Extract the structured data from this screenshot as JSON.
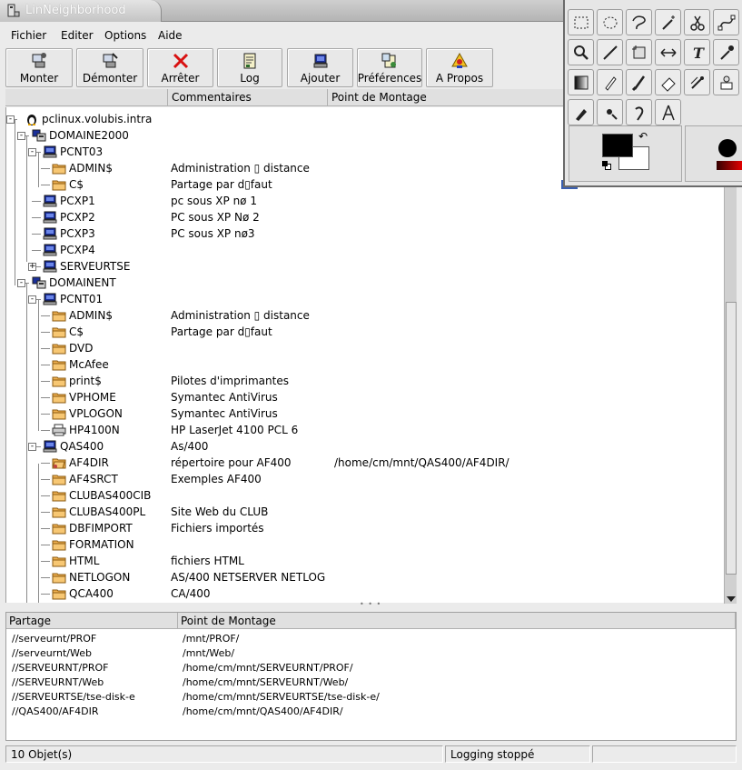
{
  "window": {
    "title": "LinNeighborhood"
  },
  "menu": [
    "Fichier",
    "Editer",
    "Options",
    "Aide"
  ],
  "toolbar": [
    {
      "label": "Monter",
      "icon": "mount-icon"
    },
    {
      "label": "Démonter",
      "icon": "unmount-icon"
    },
    {
      "label": "Arrêter",
      "icon": "stop-icon"
    },
    {
      "label": "Log",
      "icon": "log-icon"
    },
    {
      "label": "Ajouter",
      "icon": "add-host-icon"
    },
    {
      "label": "Préférences",
      "icon": "preferences-icon"
    },
    {
      "label": "A Propos",
      "icon": "about-icon"
    }
  ],
  "tree_columns": [
    "",
    "Commentaires",
    "Point de Montage"
  ],
  "tree": [
    {
      "name": "pclinux.volubis.intra",
      "type": "root",
      "depth": 0,
      "expander": "-",
      "comment": "",
      "mount": ""
    },
    {
      "name": "DOMAINE2000",
      "type": "domain",
      "depth": 1,
      "expander": "-",
      "comment": "",
      "mount": ""
    },
    {
      "name": "PCNT03",
      "type": "host",
      "depth": 2,
      "expander": "-",
      "comment": "",
      "mount": ""
    },
    {
      "name": "ADMIN$",
      "type": "folder",
      "depth": 3,
      "comment": "Administration ▯ distance",
      "mount": ""
    },
    {
      "name": "C$",
      "type": "folder",
      "depth": 3,
      "comment": "Partage par d▯faut",
      "mount": ""
    },
    {
      "name": "PCXP1",
      "type": "host",
      "depth": 2,
      "comment": "pc sous XP nø 1",
      "mount": ""
    },
    {
      "name": "PCXP2",
      "type": "host",
      "depth": 2,
      "comment": "PC sous XP Nø 2",
      "mount": ""
    },
    {
      "name": "PCXP3",
      "type": "host",
      "depth": 2,
      "comment": "PC sous XP nø3",
      "mount": ""
    },
    {
      "name": "PCXP4",
      "type": "host",
      "depth": 2,
      "comment": "",
      "mount": ""
    },
    {
      "name": "SERVEURTSE",
      "type": "host",
      "depth": 2,
      "expander": "+",
      "comment": "",
      "mount": ""
    },
    {
      "name": "DOMAINENT",
      "type": "domain",
      "depth": 1,
      "expander": "-",
      "comment": "",
      "mount": ""
    },
    {
      "name": "PCNT01",
      "type": "host",
      "depth": 2,
      "expander": "-",
      "comment": "",
      "mount": ""
    },
    {
      "name": "ADMIN$",
      "type": "folder",
      "depth": 3,
      "comment": "Administration ▯ distance",
      "mount": ""
    },
    {
      "name": "C$",
      "type": "folder",
      "depth": 3,
      "comment": "Partage par d▯faut",
      "mount": ""
    },
    {
      "name": "DVD",
      "type": "folder",
      "depth": 3,
      "comment": "",
      "mount": ""
    },
    {
      "name": "McAfee",
      "type": "folder",
      "depth": 3,
      "comment": "",
      "mount": ""
    },
    {
      "name": "print$",
      "type": "folder",
      "depth": 3,
      "comment": "Pilotes d'imprimantes",
      "mount": ""
    },
    {
      "name": "VPHOME",
      "type": "folder",
      "depth": 3,
      "comment": "Symantec AntiVirus",
      "mount": ""
    },
    {
      "name": "VPLOGON",
      "type": "folder",
      "depth": 3,
      "comment": "Symantec AntiVirus",
      "mount": ""
    },
    {
      "name": "HP4100N",
      "type": "printer",
      "depth": 3,
      "comment": "HP LaserJet 4100 PCL 6",
      "mount": ""
    },
    {
      "name": "QAS400",
      "type": "host",
      "depth": 2,
      "expander": "-",
      "comment": "As/400",
      "mount": ""
    },
    {
      "name": "AF4DIR",
      "type": "folder-mounted",
      "depth": 3,
      "comment": "répertoire pour AF400",
      "mount": "/home/cm/mnt/QAS400/AF4DIR/"
    },
    {
      "name": "AF4SRCT",
      "type": "folder",
      "depth": 3,
      "comment": "Exemples AF400",
      "mount": ""
    },
    {
      "name": "CLUBAS400CIB",
      "type": "folder",
      "depth": 3,
      "comment": "",
      "mount": ""
    },
    {
      "name": "CLUBAS400PL",
      "type": "folder",
      "depth": 3,
      "comment": "Site Web du CLUB",
      "mount": ""
    },
    {
      "name": "DBFIMPORT",
      "type": "folder",
      "depth": 3,
      "comment": "Fichiers importés",
      "mount": ""
    },
    {
      "name": "FORMATION",
      "type": "folder",
      "depth": 3,
      "comment": "",
      "mount": ""
    },
    {
      "name": "HTML",
      "type": "folder",
      "depth": 3,
      "comment": "fichiers HTML",
      "mount": ""
    },
    {
      "name": "NETLOGON",
      "type": "folder",
      "depth": 3,
      "comment": "AS/400 NETSERVER NETLOG",
      "mount": ""
    },
    {
      "name": "QCA400",
      "type": "folder",
      "depth": 3,
      "comment": "CA/400",
      "mount": ""
    }
  ],
  "splitter_grip": "• • •",
  "mounts_columns": [
    "Partage",
    "Point de Montage"
  ],
  "mounts": [
    {
      "share": "//serveurnt/PROF",
      "mount": "/mnt/PROF/"
    },
    {
      "share": "//serveurnt/Web",
      "mount": "/mnt/Web/"
    },
    {
      "share": "//SERVEURNT/PROF",
      "mount": "/home/cm/mnt/SERVEURNT/PROF/"
    },
    {
      "share": "//SERVEURNT/Web",
      "mount": "/home/cm/mnt/SERVEURNT/Web/"
    },
    {
      "share": "//SERVEURTSE/tse-disk-e",
      "mount": "/home/cm/mnt/SERVEURTSE/tse-disk-e/"
    },
    {
      "share": "//QAS400/AF4DIR",
      "mount": "/home/cm/mnt/QAS400/AF4DIR/"
    }
  ],
  "status": {
    "objects": "10 Objet(s)",
    "logging": "Logging stoppé"
  },
  "palette": {
    "tools": [
      "rect-select-icon",
      "ellipse-select-icon",
      "lasso-icon",
      "magic-wand-icon",
      "scissors-select-icon",
      "bezier-path-icon",
      "zoom-icon",
      "measure-icon",
      "crop-icon",
      "flip-icon",
      "text-icon",
      "color-picker-icon",
      "gradient-icon",
      "pencil-icon",
      "paintbrush-icon",
      "eraser-icon",
      "airbrush-icon",
      "clone-icon",
      "ink-icon",
      "smudge-icon",
      "dodge-burn-icon",
      "compass-icon"
    ],
    "fg_color": "#000000",
    "bg_color": "#ffffff"
  }
}
